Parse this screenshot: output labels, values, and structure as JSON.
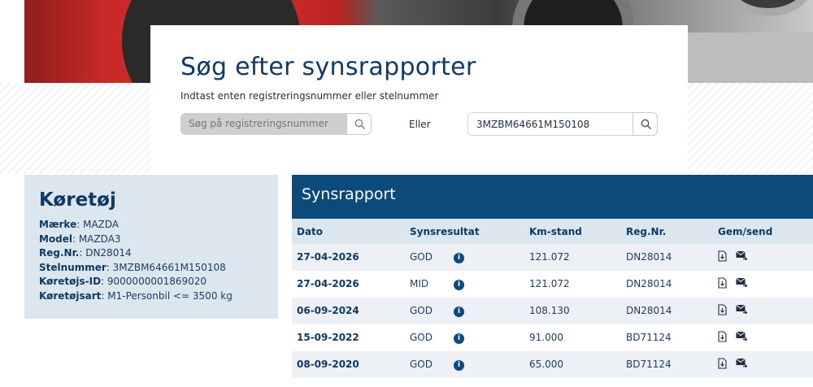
{
  "search": {
    "title": "Søg efter synsrapporter",
    "subtitle": "Indtast enten registreringsnummer eller stelnummer",
    "reg_placeholder": "Søg på registreringsnummer",
    "or_label": "Eller",
    "vin_value": "3MZBM64661M150108"
  },
  "vehicle": {
    "title": "Køretøj",
    "fields": [
      {
        "label": "Mærke",
        "value": "MAZDA"
      },
      {
        "label": "Model",
        "value": "MAZDA3"
      },
      {
        "label": "Reg.Nr.",
        "value": "DN28014"
      },
      {
        "label": "Stelnummer",
        "value": "3MZBM64661M150108"
      },
      {
        "label": "Køretøjs-ID",
        "value": "9000000001869020"
      },
      {
        "label": "Køretøjsart",
        "value": "M1-Personbil <= 3500 kg"
      }
    ]
  },
  "report": {
    "title": "Synsrapport",
    "columns": [
      "Dato",
      "Synsresultat",
      "Km-stand",
      "Reg.Nr.",
      "Gem/send"
    ],
    "rows": [
      {
        "date": "27-04-2026",
        "result": "GOD",
        "km": "121.072",
        "reg": "DN28014"
      },
      {
        "date": "27-04-2026",
        "result": "MID",
        "km": "121.072",
        "reg": "DN28014"
      },
      {
        "date": "06-09-2024",
        "result": "GOD",
        "km": "108.130",
        "reg": "DN28014"
      },
      {
        "date": "15-09-2022",
        "result": "GOD",
        "km": "91.000",
        "reg": "BD71124"
      },
      {
        "date": "08-09-2020",
        "result": "GOD",
        "km": "65.000",
        "reg": "BD71124"
      }
    ]
  },
  "icons": {
    "search": "magnifier-icon",
    "info": "info-icon",
    "download": "download-icon",
    "send": "send-mail-icon"
  },
  "colors": {
    "primary": "#0b4a7a",
    "panel": "#dce6ee",
    "text": "#0f3a66"
  }
}
